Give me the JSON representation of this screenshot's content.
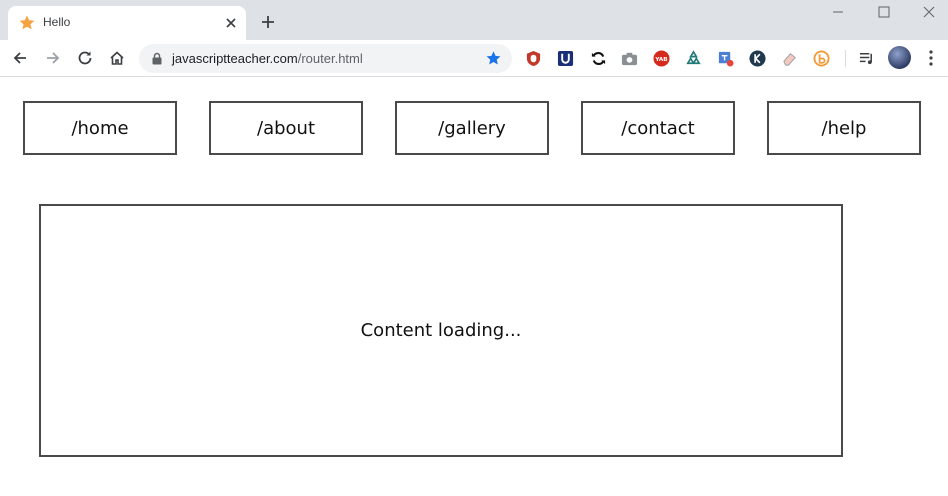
{
  "browser": {
    "tab": {
      "title": "Hello",
      "favicon": "star-icon"
    },
    "address_bar": {
      "url_host": "javascriptteacher.com",
      "url_path": "/router.html"
    },
    "extensions": [
      "ublock-icon",
      "unicode-u-icon",
      "sync-icon",
      "camera-icon",
      "yab-icon",
      "recycle-icon",
      "translate-icon",
      "k-icon",
      "eraser-icon",
      "b-icon"
    ],
    "colors": {
      "tabstrip": "#dee1e6",
      "omnibox": "#f1f3f4",
      "star": "#1a73e8",
      "favicon": "#f4a340"
    }
  },
  "nav": {
    "links": [
      {
        "label": "/home"
      },
      {
        "label": "/about"
      },
      {
        "label": "/gallery"
      },
      {
        "label": "/contact"
      },
      {
        "label": "/help"
      }
    ]
  },
  "content": {
    "text": "Content loading..."
  }
}
